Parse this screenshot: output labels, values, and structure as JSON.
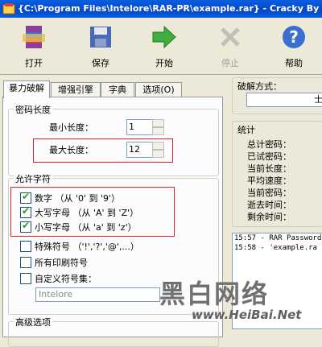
{
  "window": {
    "title": "{C:\\Program Files\\Intelore\\RAR-PR\\example.rar} - Cracky By fly"
  },
  "toolbar": {
    "open": "打开",
    "save": "保存",
    "start": "开始",
    "stop": "停止",
    "help": "帮助"
  },
  "tabs": [
    {
      "label": "暴力破解"
    },
    {
      "label": "增强引擎"
    },
    {
      "label": "字典"
    },
    {
      "label": "选项(O)"
    }
  ],
  "length_group": {
    "title": "密码长度",
    "min_label": "最小长度：",
    "min_value": "1",
    "max_label": "最大长度：",
    "max_value": "12"
  },
  "charset_group": {
    "title": "允许字符",
    "items": [
      {
        "label": "数字 （从 '0' 到 '9'）",
        "checked": true
      },
      {
        "label": "大写字母 （从 'A' 到 'Z'）",
        "checked": true
      },
      {
        "label": "小写字母 （从 'a' 到 'z'）",
        "checked": true
      },
      {
        "label": "特殊符号 （'!','?','@',...）",
        "checked": false
      },
      {
        "label": "所有印刷符号",
        "checked": false
      },
      {
        "label": "自定义符号集：",
        "checked": false
      }
    ],
    "custom_value": "Intelore"
  },
  "advanced": {
    "title": "高级选项"
  },
  "mode": {
    "title": "破解方式：",
    "value": "士"
  },
  "stats": {
    "title": "统计",
    "items": [
      "总计密码：",
      "已试密码：",
      "当前长度：",
      "平均速度：",
      "当前密码：",
      "逝去时间：",
      "剩余时间："
    ]
  },
  "log": {
    "lines": [
      "15:57 - RAR Password",
      "15:58 - 'example.ra"
    ]
  },
  "watermark": {
    "text": "黑白网络",
    "url": "www.HeiBai.Net"
  },
  "colors": {
    "highlight": "#e02020",
    "title_bar": "#0a5fe0",
    "checkmark": "#21a121"
  }
}
